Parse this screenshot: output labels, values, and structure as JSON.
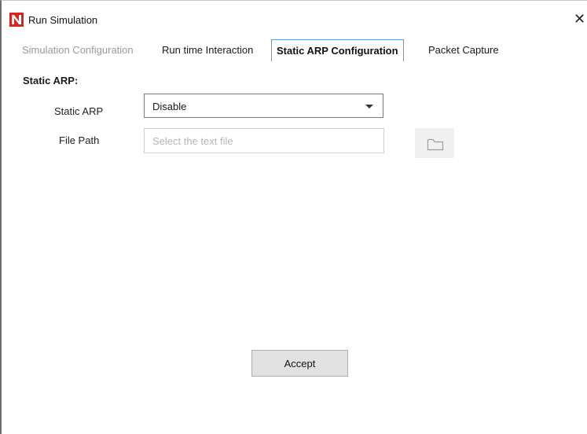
{
  "window": {
    "title": "Run Simulation",
    "close_glyph": "✕"
  },
  "icons": {
    "app": "netsim-logo-icon",
    "close": "close-icon",
    "caret": "chevron-down-icon",
    "folder": "folder-icon"
  },
  "colors": {
    "active_tab_border": "#5a9bd5",
    "logo_red": "#d7261e"
  },
  "tabs": [
    {
      "label": "Simulation Configuration",
      "state": "disabled"
    },
    {
      "label": "Run time Interaction",
      "state": "normal"
    },
    {
      "label": "Static ARP Configuration",
      "state": "active"
    },
    {
      "label": "Packet Capture",
      "state": "normal"
    }
  ],
  "form": {
    "section_title": "Static ARP:",
    "static_arp": {
      "label": "Static ARP",
      "value": "Disable"
    },
    "file_path": {
      "label": "File Path",
      "value": "",
      "placeholder": "Select the text file"
    }
  },
  "footer": {
    "accept_label": "Accept"
  }
}
